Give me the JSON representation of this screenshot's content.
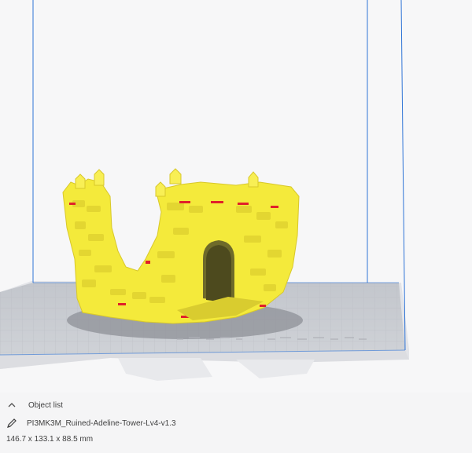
{
  "viewport": {
    "build_volume_color": "#2f74d6",
    "plate_color": "#c9cbd1",
    "model_color": "#f4ea3b",
    "overhang_color": "#e0202a"
  },
  "object_list": {
    "label": "Object list",
    "toggle_icon": "chevron-up-icon",
    "edit_icon": "pencil-icon",
    "object_name": "PI3MK3M_Ruined-Adeline-Tower-Lv4-v1.3",
    "dimensions": "146.7 x 133.1 x 88.5 mm"
  }
}
